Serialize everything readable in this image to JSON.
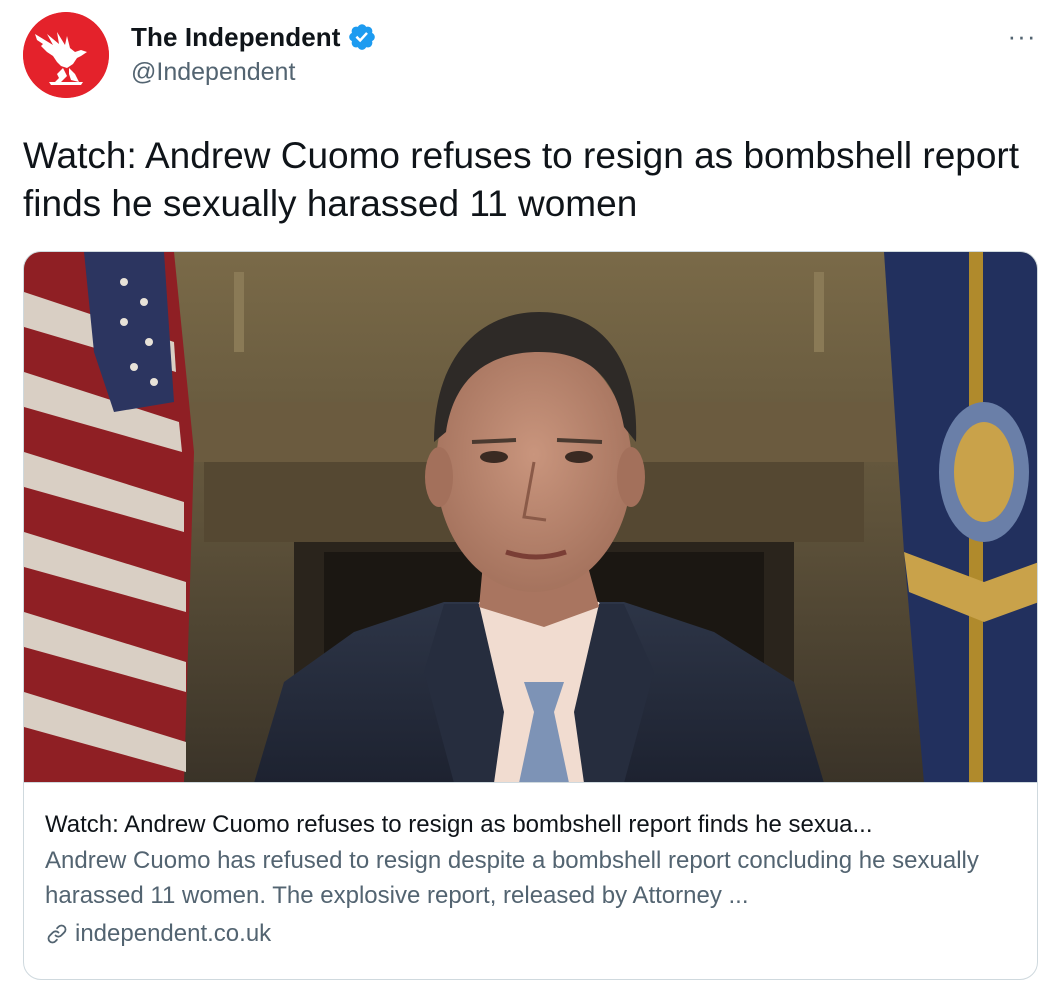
{
  "author": {
    "name": "The Independent",
    "handle": "@Independent",
    "avatar_color": "#e4222b",
    "avatar_icon": "eagle-logo",
    "verified_color": "#1d9bf0"
  },
  "tweet": {
    "text": "Watch: Andrew Cuomo refuses to resign as bombshell report finds he sexually harassed 11 women",
    "more_icon": "more-horizontal-icon",
    "more_label": "···"
  },
  "card": {
    "image_alt": "Andrew Cuomo seated before American and New York state flags",
    "title": "Watch: Andrew Cuomo refuses to resign as bombshell report finds he sexua...",
    "description": "Andrew Cuomo has refused to resign despite a bombshell report concluding he sexually harassed 11 women. The explosive report, released by Attorney ...",
    "domain": "independent.co.uk",
    "domain_icon": "link-icon"
  },
  "colors": {
    "text_primary": "#0f1419",
    "text_secondary": "#536471",
    "border": "#cfd9de"
  }
}
